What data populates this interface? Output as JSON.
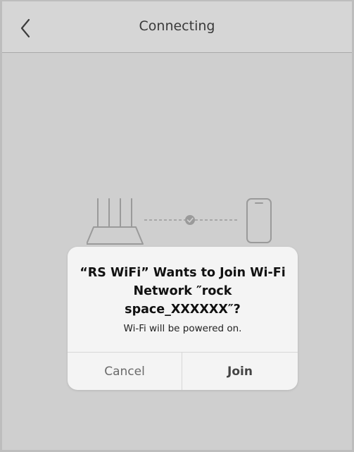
{
  "header": {
    "title": "Connecting",
    "back_icon": "chevron-left-icon"
  },
  "illustration": {
    "router_icon": "router-icon",
    "link_icon": "check-circle-icon",
    "phone_icon": "phone-icon"
  },
  "alert": {
    "title": "“RS WiFi” Wants to Join Wi-Fi Network ″rock space_XXXXXX″?",
    "message": "Wi-Fi will be powered on.",
    "cancel_label": "Cancel",
    "join_label": "Join"
  },
  "colors": {
    "overlay_bg": "#cfcfcf",
    "alert_bg": "#f4f4f4",
    "icon_gray": "#9a9a9a"
  }
}
